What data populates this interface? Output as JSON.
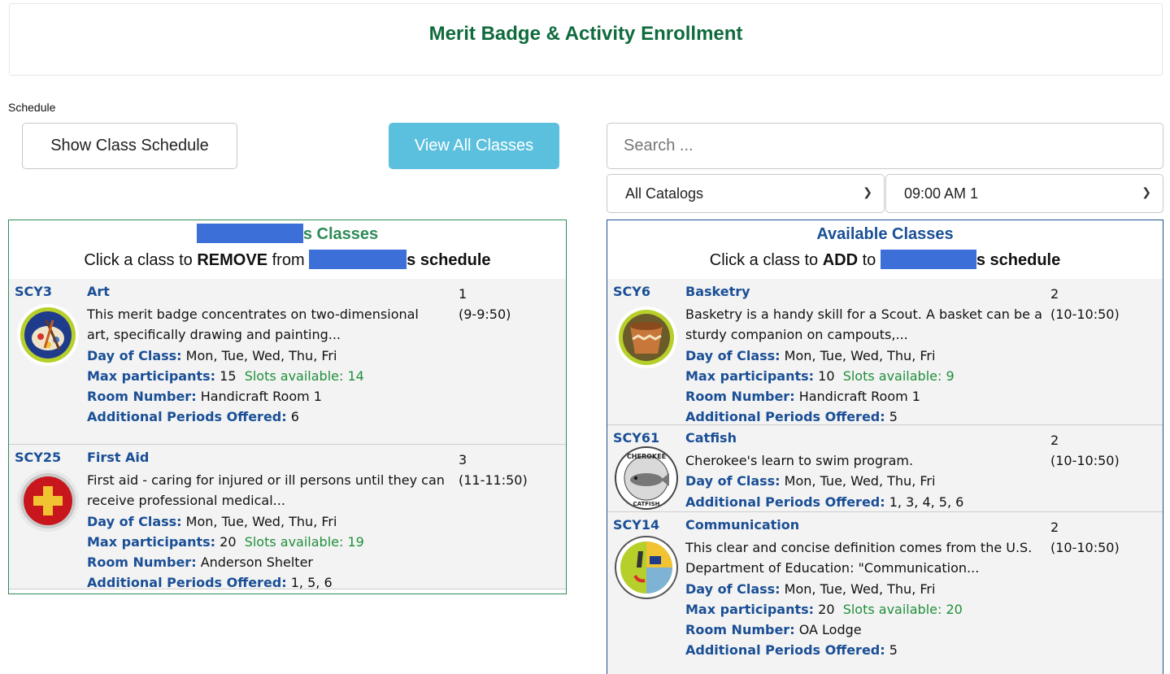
{
  "header": {
    "title": "Merit Badge & Activity Enrollment"
  },
  "schedule_label": "Schedule",
  "buttons": {
    "show_schedule": "Show Class Schedule",
    "view_all": "View All Classes"
  },
  "search": {
    "placeholder": "Search ..."
  },
  "filters": {
    "catalog": "All Catalogs",
    "time": "09:00 AM 1"
  },
  "my_classes": {
    "title_suffix": "s Classes",
    "subtitle_prefix": "Click a class to ",
    "subtitle_action": "REMOVE",
    "subtitle_mid": " from ",
    "subtitle_suffix": "s schedule",
    "items": [
      {
        "code": "SCY3",
        "name": "Art",
        "period": "1",
        "time": "(9-9:50)",
        "description": "This merit badge concentrates on two-dimensional art, specifically drawing and painting...",
        "day_label": "Day of Class:",
        "days": "Mon, Tue, Wed, Thu, Fri",
        "max_label": "Max participants:",
        "max": "15",
        "slots": "Slots available: 14",
        "room_label": "Room Number:",
        "room": "Handicraft Room 1",
        "periods_label": "Additional Periods Offered:",
        "periods": "6",
        "icon": "art-badge-icon"
      },
      {
        "code": "SCY25",
        "name": "First Aid",
        "period": "3",
        "time": "(11-11:50)",
        "description": "First aid - caring for injured or ill persons until they can receive professional medical...",
        "day_label": "Day of Class:",
        "days": "Mon, Tue, Wed, Thu, Fri",
        "max_label": "Max participants:",
        "max": "20",
        "slots": "Slots available: 19",
        "room_label": "Room Number:",
        "room": "Anderson Shelter",
        "periods_label": "Additional Periods Offered:",
        "periods": "1, 5, 6",
        "icon": "first-aid-badge-icon"
      }
    ]
  },
  "available": {
    "title": "Available Classes",
    "subtitle_prefix": "Click a class to ",
    "subtitle_action": "ADD",
    "subtitle_mid": " to ",
    "subtitle_suffix": "s schedule",
    "items": [
      {
        "code": "SCY6",
        "name": "Basketry",
        "period": "2",
        "time": "(10-10:50)",
        "description": "Basketry is a handy skill for a Scout. A basket can be a sturdy companion on campouts,...",
        "day_label": "Day of Class:",
        "days": "Mon, Tue, Wed, Thu, Fri",
        "max_label": "Max participants:",
        "max": "10",
        "slots": "Slots available: 9",
        "room_label": "Room Number:",
        "room": "Handicraft Room 1",
        "periods_label": "Additional Periods Offered:",
        "periods": "5",
        "icon": "basketry-badge-icon"
      },
      {
        "code": "SCY61",
        "name": "Catfish",
        "period": "2",
        "time": "(10-10:50)",
        "description": "Cherokee's learn to swim program.",
        "day_label": "Day of Class:",
        "days": "Mon, Tue, Wed, Thu, Fri",
        "periods_label": "Additional Periods Offered:",
        "periods": "1, 3, 4, 5, 6",
        "icon": "catfish-badge-icon",
        "badge_text_top": "CHEROKEE",
        "badge_text_bottom": "CATFISH"
      },
      {
        "code": "SCY14",
        "name": "Communication",
        "period": "2",
        "time": "(10-10:50)",
        "description": "This clear and concise definition comes from the U.S. Department of Education: \"Communication...",
        "day_label": "Day of Class:",
        "days": "Mon, Tue, Wed, Thu, Fri",
        "max_label": "Max participants:",
        "max": "20",
        "slots": "Slots available: 20",
        "room_label": "Room Number:",
        "room": "OA Lodge",
        "periods_label": "Additional Periods Offered:",
        "periods": "5",
        "icon": "communication-badge-icon"
      }
    ]
  },
  "colors": {
    "title_green": "#0f6b3c",
    "panel_green": "#2e8b57",
    "link_blue": "#1a4f96",
    "button_info": "#5bc0de",
    "slots_green": "#1f8f3a",
    "redaction": "#3c70d8"
  }
}
